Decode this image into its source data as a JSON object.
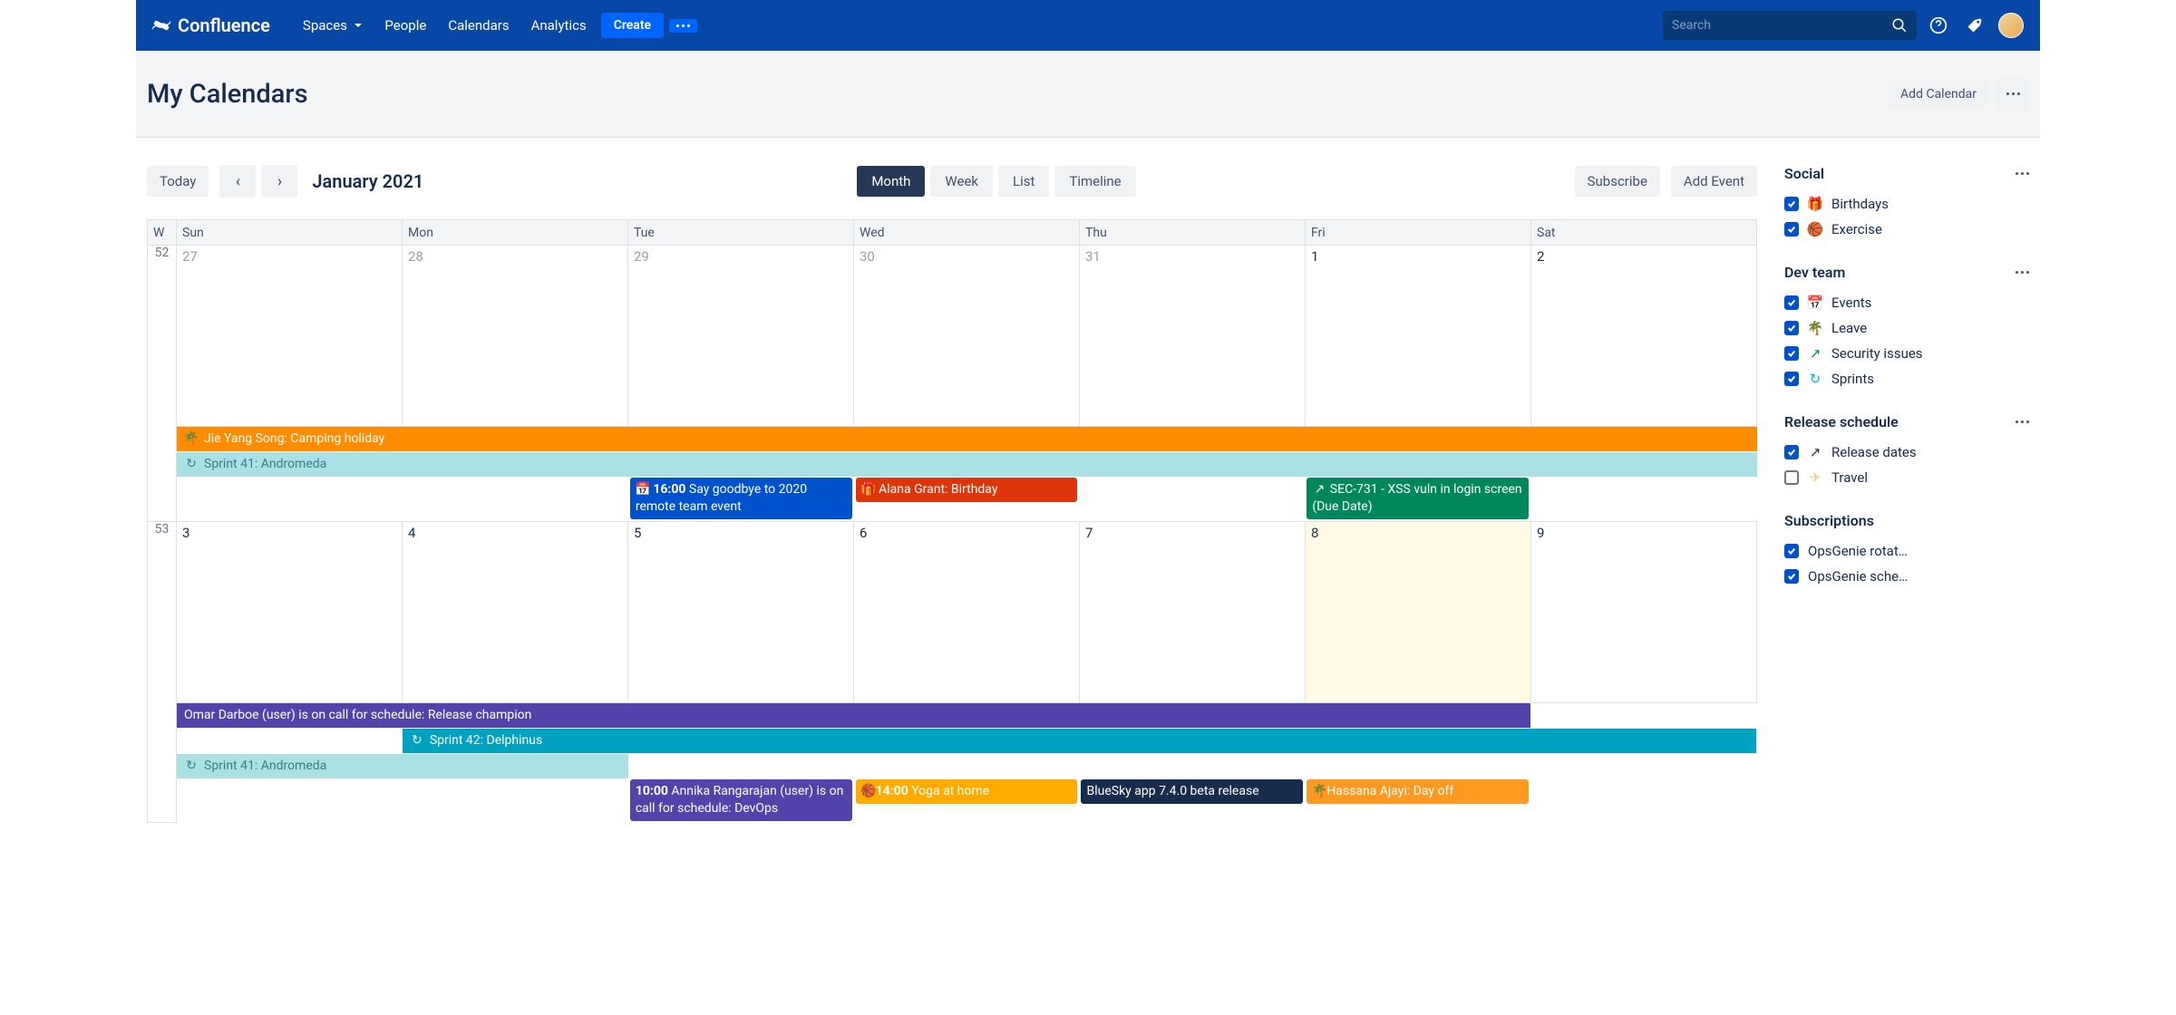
{
  "nav": {
    "brand": "Confluence",
    "items": [
      "Spaces",
      "People",
      "Calendars",
      "Analytics"
    ],
    "create": "Create",
    "search_placeholder": "Search"
  },
  "header": {
    "title": "My Calendars",
    "add_calendar": "Add Calendar"
  },
  "toolbar": {
    "today": "Today",
    "period": "January 2021",
    "views": [
      "Month",
      "Week",
      "List",
      "Timeline"
    ],
    "active_view": "Month",
    "subscribe": "Subscribe",
    "add_event": "Add Event"
  },
  "calendar": {
    "day_headers": [
      "W",
      "Sun",
      "Mon",
      "Tue",
      "Wed",
      "Thu",
      "Fri",
      "Sat"
    ],
    "week1": {
      "wk": "52",
      "days": [
        "27",
        "28",
        "29",
        "30",
        "31",
        "1",
        "2"
      ]
    },
    "week2": {
      "wk": "53",
      "days": [
        "3",
        "4",
        "5",
        "6",
        "7",
        "8",
        "9"
      ]
    }
  },
  "events": {
    "camping": "Jie Yang Song: Camping holiday",
    "sprint41": "Sprint 41: Andromeda",
    "goodbye_time": "16:00",
    "goodbye_text": "Say goodbye to 2020 remote team event",
    "alana": "Alana Grant: Birthday",
    "sec731": "SEC-731 - XSS vuln in login screen (Due Date)",
    "omar": "Omar Darboe (user) is on call for schedule: Release champion",
    "sprint42": "Sprint 42: Delphinus",
    "sprint41b": "Sprint 41: Andromeda",
    "annika_time": "10:00",
    "annika_text": "Annika Rangarajan (user) is on call for schedule: DevOps",
    "yoga_time": "14:00",
    "yoga_text": "Yoga at home",
    "bluesky": "BlueSky app 7.4.0 beta release",
    "hassana": "Hassana Ajayi: Day off"
  },
  "sidebar": {
    "groups": [
      {
        "name": "Social",
        "items": [
          {
            "label": "Birthdays",
            "color": "#de350b",
            "icon": "gift",
            "checked": true
          },
          {
            "label": "Exercise",
            "color": "#ffab00",
            "icon": "ball",
            "checked": true
          }
        ]
      },
      {
        "name": "Dev team",
        "items": [
          {
            "label": "Events",
            "color": "#0747a6",
            "icon": "cal",
            "checked": true
          },
          {
            "label": "Leave",
            "color": "#ff8b00",
            "icon": "palm",
            "checked": true
          },
          {
            "label": "Security issues",
            "color": "#00875a",
            "icon": "arrow",
            "checked": true
          },
          {
            "label": "Sprints",
            "color": "#00b8d9",
            "icon": "cycle",
            "checked": true
          }
        ]
      },
      {
        "name": "Release schedule",
        "items": [
          {
            "label": "Release dates",
            "color": "#172b4d",
            "icon": "arrow",
            "checked": true
          },
          {
            "label": "Travel",
            "color": "#f5cf88",
            "icon": "plane",
            "checked": false
          }
        ]
      },
      {
        "name": "Subscriptions",
        "no_dots": true,
        "items": [
          {
            "label": "OpsGenie rotat…",
            "color": "#5243aa",
            "icon": "none",
            "checked": true
          },
          {
            "label": "OpsGenie sche…",
            "color": "#5243aa",
            "icon": "none",
            "checked": true
          }
        ]
      }
    ]
  },
  "colors": {
    "orange": "#ff8b00",
    "teal_light": "#abe0e4",
    "teal_light_text": "#3a7f87",
    "blue": "#0052cc",
    "red": "#de350b",
    "green": "#00875a",
    "purple": "#5243aa",
    "teal": "#00a3bf",
    "yellow": "#ffab00",
    "navy": "#172b4d"
  }
}
